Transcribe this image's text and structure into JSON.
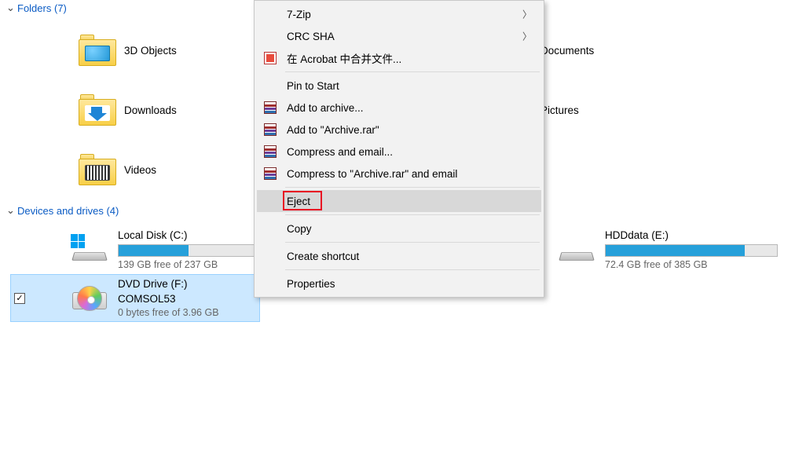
{
  "sections": {
    "folders": {
      "title": "Folders",
      "count": 7
    },
    "drives": {
      "title": "Devices and drives",
      "count": 4
    }
  },
  "folders": {
    "f1": "3D Objects",
    "f2": "Documents",
    "f3": "Downloads",
    "f4": "Pictures",
    "f5": "Videos"
  },
  "drives": {
    "d1": {
      "name": "Local Disk (C:)",
      "free_text": "139 GB free of 237 GB",
      "used_percent": 41
    },
    "d2": {
      "name": "HDDdata (E:)",
      "free_text": "72.4 GB free of 385 GB",
      "used_percent": 81
    },
    "d3": {
      "name": "DVD Drive (F:)",
      "label": "COMSOL53",
      "free_text": "0 bytes free of 3.96 GB"
    }
  },
  "context_menu": {
    "seven_zip": "7-Zip",
    "crc_sha": "CRC SHA",
    "acrobat": "在 Acrobat 中合并文件...",
    "pin_start": "Pin to Start",
    "add_archive": "Add to archive...",
    "add_archive_rar": "Add to \"Archive.rar\"",
    "compress_email": "Compress and email...",
    "compress_rar_email": "Compress to \"Archive.rar\" and email",
    "eject": "Eject",
    "copy": "Copy",
    "create_shortcut": "Create shortcut",
    "properties": "Properties"
  }
}
